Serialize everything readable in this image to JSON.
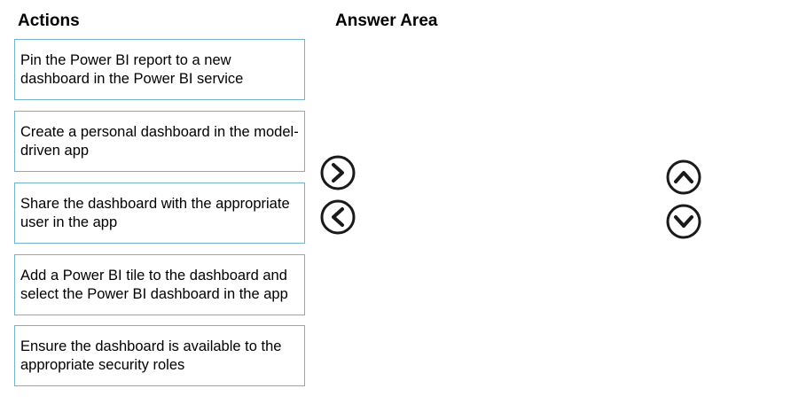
{
  "headings": {
    "actions": "Actions",
    "answer_area": "Answer Area"
  },
  "actions": [
    {
      "label": "Pin the Power BI report to a new dashboard in the Power BI service"
    },
    {
      "label": "Create a personal dashboard in the model-driven app"
    },
    {
      "label": "Share the dashboard with the appropriate user in the app"
    },
    {
      "label": "Add a Power BI tile to the dashboard and select the Power BI dashboard in the app"
    },
    {
      "label": "Ensure the dashboard is available to the appropriate security roles"
    }
  ],
  "controls": {
    "move_right_icon": "chevron-right-icon",
    "move_left_icon": "chevron-left-icon",
    "move_up_icon": "chevron-up-icon",
    "move_down_icon": "chevron-down-icon"
  },
  "colors": {
    "box_border": "#73b3d0",
    "text": "#000000",
    "icon": "#1a1a1a"
  }
}
